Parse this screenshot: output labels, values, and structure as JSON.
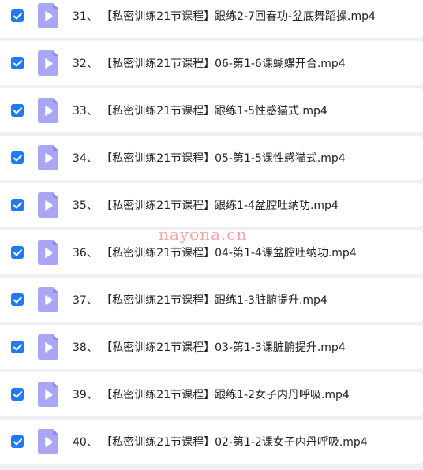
{
  "files": [
    {
      "number": "31、",
      "name": "【私密训练21节课程】跟练2-7回春功-盆底舞蹈操.mp4",
      "checked": true
    },
    {
      "number": "32、",
      "name": "【私密训练21节课程】06-第1-6课蝴蝶开合.mp4",
      "checked": true
    },
    {
      "number": "33、",
      "name": "【私密训练21节课程】跟练1-5性感猫式.mp4",
      "checked": true
    },
    {
      "number": "34、",
      "name": "【私密训练21节课程】05-第1-5课性感猫式.mp4",
      "checked": true
    },
    {
      "number": "35、",
      "name": "【私密训练21节课程】跟练1-4盆腔吐纳功.mp4",
      "checked": true
    },
    {
      "number": "36、",
      "name": "【私密训练21节课程】04-第1-4课盆腔吐纳功.mp4",
      "checked": true
    },
    {
      "number": "37、",
      "name": "【私密训练21节课程】跟练1-3脏腑提升.mp4",
      "checked": true
    },
    {
      "number": "38、",
      "name": "【私密训练21节课程】03-第1-3课脏腑提升.mp4",
      "checked": true
    },
    {
      "number": "39、",
      "name": "【私密训练21节课程】跟练1-2女子内丹呼吸.mp4",
      "checked": true
    },
    {
      "number": "40、",
      "name": "【私密训练21节课程】02-第1-2课女子内丹呼吸.mp4",
      "checked": true
    }
  ],
  "watermark": "nayona.cn",
  "colors": {
    "checkbox": "#1e7bf3",
    "file_icon": "#a9a6f6",
    "file_icon_fold": "#8d89ee",
    "row_background": "#ffffff",
    "page_background": "#eef0f5",
    "watermark": "#f2a8a8"
  },
  "icons": {
    "checkbox": "checkbox-checked-icon",
    "file": "video-file-icon"
  }
}
